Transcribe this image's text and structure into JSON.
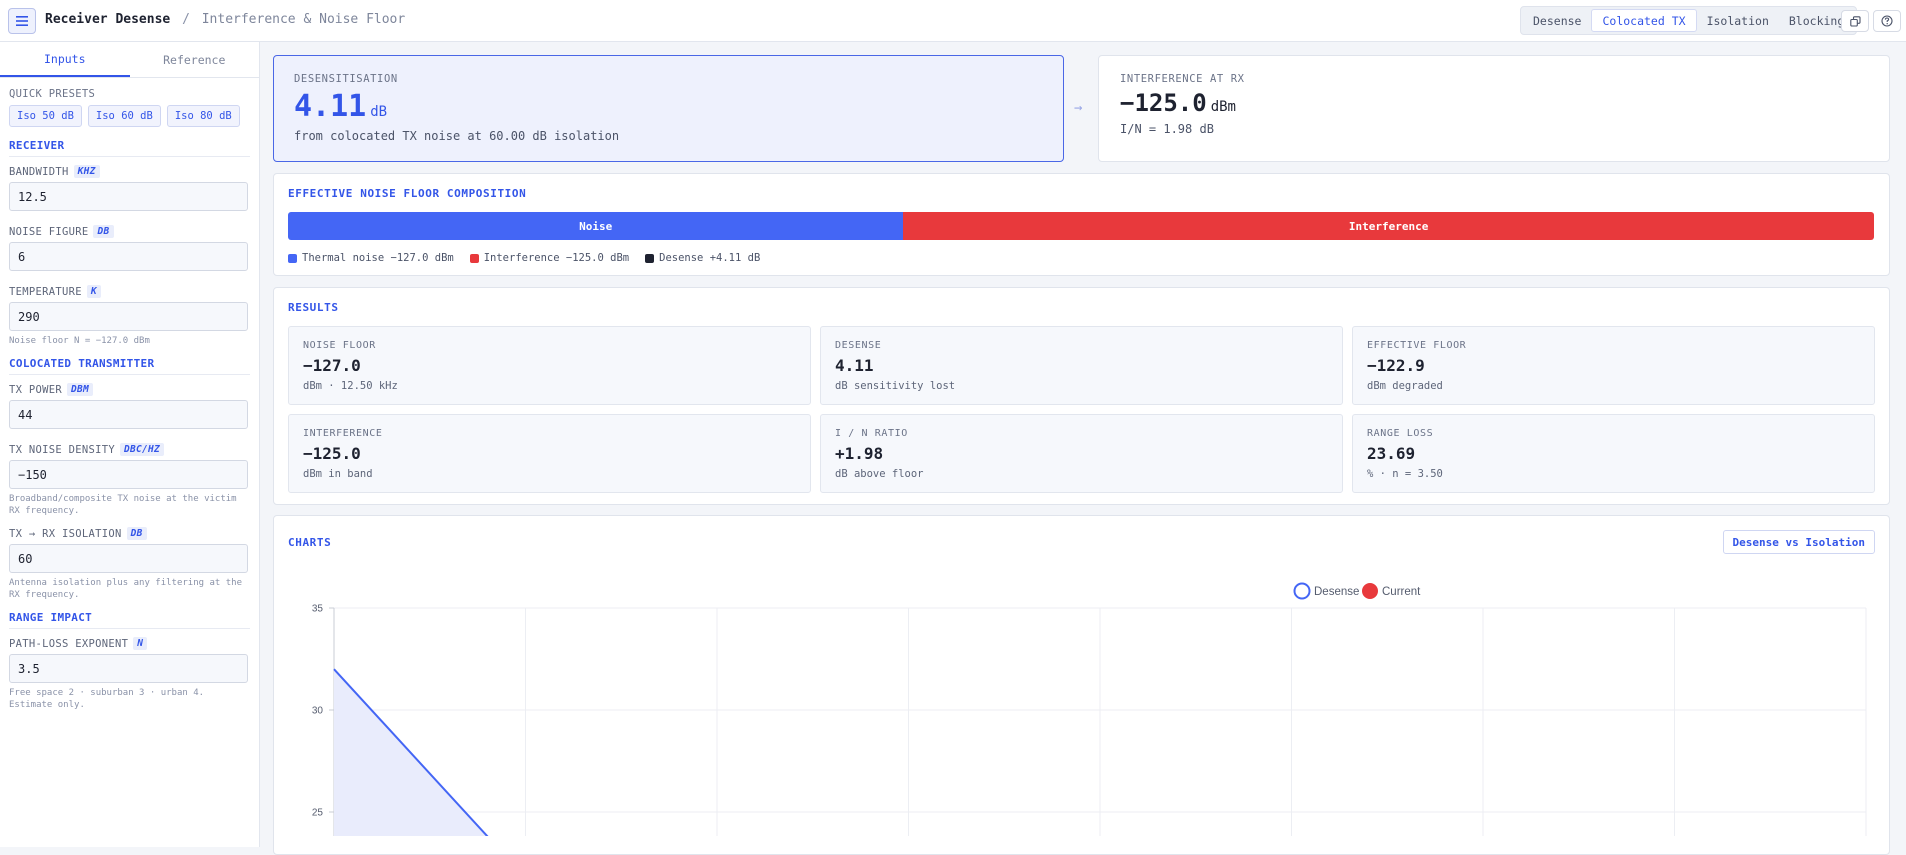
{
  "header": {
    "title": "Receiver Desense",
    "separator": "/",
    "subtitle": "Interference & Noise Floor",
    "tabs": [
      "Desense",
      "Colocated TX",
      "Isolation",
      "Blocking"
    ],
    "active_tab": "Colocated TX",
    "icons": [
      "menu-icon",
      "copy-icon",
      "help-icon"
    ]
  },
  "sidebar": {
    "tabs": [
      "Inputs",
      "Reference"
    ],
    "active_tab": "Inputs",
    "quick_presets_label": "QUICK PRESETS",
    "presets": [
      "Iso 50 dB",
      "Iso 60 dB",
      "Iso 80 dB"
    ],
    "receiver": {
      "title": "RECEIVER",
      "bandwidth": {
        "label": "BANDWIDTH",
        "unit": "KHZ",
        "value": "12.5"
      },
      "noise_figure": {
        "label": "NOISE FIGURE",
        "unit": "DB",
        "value": "6"
      },
      "temperature": {
        "label": "TEMPERATURE",
        "unit": "K",
        "value": "290"
      },
      "hint": "Noise floor N = −127.0 dBm"
    },
    "transmitter": {
      "title": "COLOCATED TRANSMITTER",
      "tx_power": {
        "label": "TX POWER",
        "unit": "DBM",
        "value": "44"
      },
      "tx_noise": {
        "label": "TX NOISE DENSITY",
        "unit": "DBC/HZ",
        "value": "−150"
      },
      "tx_noise_hint": "Broadband/composite TX noise at the victim RX frequency.",
      "isolation": {
        "label": "TX → RX ISOLATION",
        "unit": "DB",
        "value": "60"
      },
      "isolation_hint": "Antenna isolation plus any filtering at the RX frequency."
    },
    "range": {
      "title": "RANGE IMPACT",
      "exponent": {
        "label": "PATH-LOSS EXPONENT",
        "unit": "N",
        "value": "3.5"
      },
      "hint": "Free space 2 · suburban 3 · urban 4. Estimate only."
    }
  },
  "hero": {
    "desense": {
      "label": "DESENSITISATION",
      "value": "4.11",
      "unit": "dB",
      "sub": "from colocated TX noise at 60.00 dB isolation"
    },
    "arrow": "→",
    "interference": {
      "label": "INTERFERENCE AT RX",
      "value": "−125.0",
      "unit": "dBm",
      "sub": "I/N = 1.98 dB"
    }
  },
  "composition": {
    "title": "EFFECTIVE NOISE FLOOR COMPOSITION",
    "segments": [
      {
        "label": "Noise",
        "fraction": 0.388,
        "color": "#4466f5"
      },
      {
        "label": "Interference",
        "fraction": 0.612,
        "color": "#e8393c"
      }
    ],
    "legend": [
      {
        "text": "Thermal noise −127.0 dBm",
        "color": "#4466f5"
      },
      {
        "text": "Interference −125.0 dBm",
        "color": "#e8393c"
      },
      {
        "text": "Desense +4.11 dB",
        "color": "#1e2230"
      }
    ]
  },
  "results": {
    "title": "RESULTS",
    "tiles": [
      {
        "label": "NOISE FLOOR",
        "value": "−127.0",
        "sub": "dBm · 12.50 kHz"
      },
      {
        "label": "DESENSE",
        "value": "4.11",
        "sub": "dB sensitivity lost"
      },
      {
        "label": "EFFECTIVE FLOOR",
        "value": "−122.9",
        "sub": "dBm degraded"
      },
      {
        "label": "INTERFERENCE",
        "value": "−125.0",
        "sub": "dBm in band"
      },
      {
        "label": "I / N RATIO",
        "value": "+1.98",
        "sub": "dB above floor"
      },
      {
        "label": "RANGE LOSS",
        "value": "23.69",
        "sub": "% · n = 3.50"
      }
    ]
  },
  "charts": {
    "title": "CHARTS",
    "button": "Desense vs Isolation"
  },
  "chart_data": {
    "type": "line",
    "series": [
      {
        "name": "Desense",
        "color": "#4466f5",
        "x": [
          30,
          35
        ],
        "y": [
          32,
          23
        ]
      },
      {
        "name": "Current",
        "color": "#e8393c",
        "x": [],
        "y": []
      }
    ],
    "ytick_labels": [
      "35",
      "30",
      "25"
    ],
    "ylim_visible": [
      22,
      35
    ],
    "x_gridlines": 8,
    "grid": true,
    "legend": "top-center"
  }
}
